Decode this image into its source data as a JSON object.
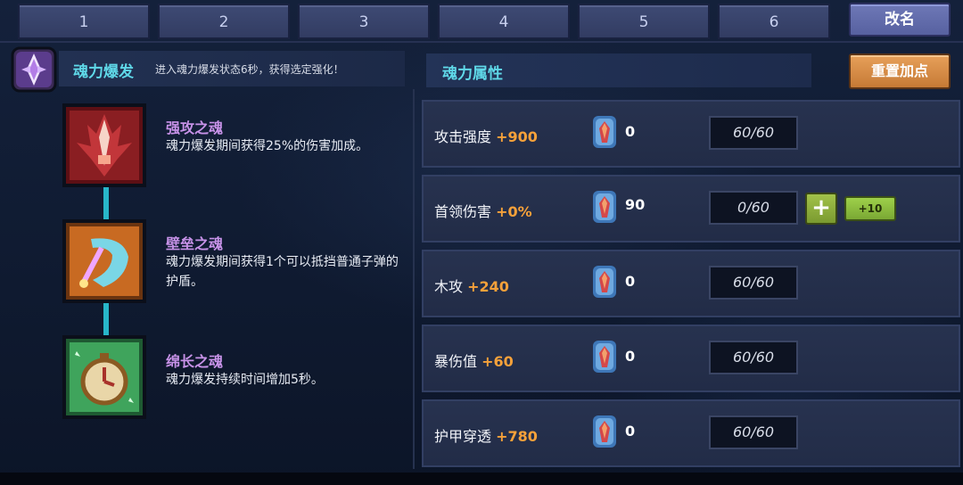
{
  "tabs": [
    "1",
    "2",
    "3",
    "4",
    "5",
    "6"
  ],
  "rename_label": "改名",
  "burst": {
    "title": "魂力爆发",
    "description": "进入魂力爆发状态6秒，获得选定强化！"
  },
  "skills": [
    {
      "name": "强攻之魂",
      "description": "魂力爆发期间获得25%的伤害加成。",
      "icon": "red-attack-soul-icon"
    },
    {
      "name": "壁垒之魂",
      "description": "魂力爆发期间获得1个可以抵挡普通子弹的护盾。",
      "icon": "orange-shield-soul-icon"
    },
    {
      "name": "绵长之魂",
      "description": "魂力爆发持续时间增加5秒。",
      "icon": "green-clock-soul-icon"
    }
  ],
  "attributes_title": "魂力属性",
  "reset_label": "重置加点",
  "attributes": [
    {
      "name": "攻击强度",
      "bonus": "+900",
      "gems": "0",
      "level": "60/60"
    },
    {
      "name": "首领伤害",
      "bonus": "+0%",
      "gems": "90",
      "level": "0/60",
      "plus_label": "+",
      "plus10_label": "+10"
    },
    {
      "name": "木攻",
      "bonus": "+240",
      "gems": "0",
      "level": "60/60"
    },
    {
      "name": "暴伤值",
      "bonus": "+60",
      "gems": "0",
      "level": "60/60"
    },
    {
      "name": "护甲穿透",
      "bonus": "+780",
      "gems": "0",
      "level": "60/60"
    }
  ],
  "colors": {
    "accent_cyan": "#5fd8e8",
    "skill_purple": "#c792e8",
    "bonus_orange": "#f6a13a",
    "reset_orange": "#d98a45",
    "add_green": "#8db43e"
  }
}
